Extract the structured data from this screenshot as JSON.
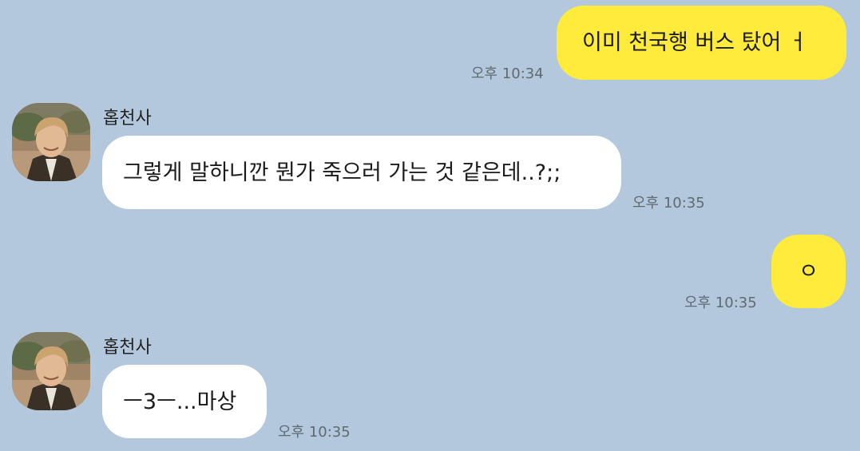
{
  "chat": {
    "messages": [
      {
        "sender": "me",
        "text": "이미 천국행 버스 탔어 ㅓ",
        "time": "오후 10:34"
      },
      {
        "sender": "홉천사",
        "text": "그렇게 말하니깐 뭔가 죽으러 가는 것 같은데..?;;",
        "time": "오후 10:35"
      },
      {
        "sender": "me",
        "text": "ㅇ",
        "time": "오후 10:35"
      },
      {
        "sender": "홉천사",
        "text": "ㅡ3ㅡ...마상",
        "time": "오후 10:35"
      }
    ]
  },
  "contact": {
    "name": "홉천사",
    "avatar_icon": "profile-photo"
  },
  "colors": {
    "background": "#b3c8dc",
    "my_bubble": "#ffeb3b",
    "their_bubble": "#ffffff",
    "timestamp": "#606a73"
  }
}
